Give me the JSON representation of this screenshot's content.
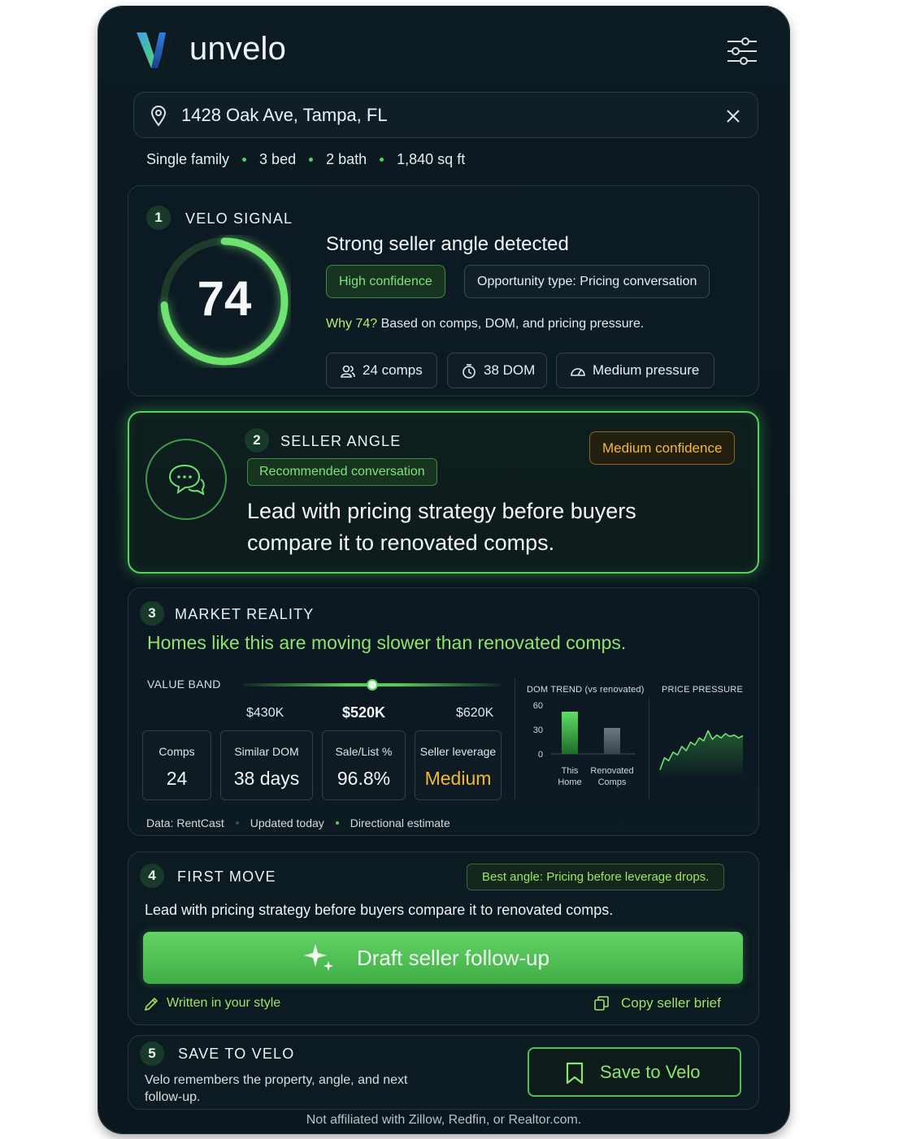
{
  "app": {
    "name": "unvelo"
  },
  "search": {
    "value": "1428 Oak Ave, Tampa, FL"
  },
  "facts": [
    "Single family",
    "3 bed",
    "2 bath",
    "1,840 sq ft"
  ],
  "signal": {
    "step": "1",
    "title": "VELO SIGNAL",
    "score": "74",
    "score_value": 74,
    "score_max": 100,
    "headline": "Strong seller angle detected",
    "confidence": "High confidence",
    "opportunity": "Opportunity type: Pricing conversation",
    "why_lead": "Why 74?",
    "why_text": " Based on comps, DOM, and pricing pressure.",
    "chips": [
      "24 comps",
      "38 DOM",
      "Medium pressure"
    ]
  },
  "seller_angle": {
    "step": "2",
    "title": "SELLER ANGLE",
    "confidence": "Medium confidence",
    "tag": "Recommended conversation",
    "message": "Lead with pricing strategy before buyers compare it to renovated comps."
  },
  "market": {
    "step": "3",
    "title": "MARKET REALITY",
    "subtitle": "Homes like this are moving slower than renovated comps.",
    "value_band": {
      "label": "VALUE BAND",
      "low": "$430K",
      "mid": "$520K",
      "high": "$620K",
      "position": 0.5
    },
    "stats": [
      {
        "label": "Comps",
        "value": "24"
      },
      {
        "label": "Similar DOM",
        "value": "38 days"
      },
      {
        "label": "Sale/List %",
        "value": "96.8%"
      },
      {
        "label": "Seller leverage",
        "value": "Medium"
      }
    ],
    "footer": [
      "Data: RentCast",
      "Updated today",
      "Directional estimate"
    ],
    "dom_trend_title": "DOM TREND (vs renovated)",
    "price_pressure_title": "PRICE PRESSURE"
  },
  "chart_data": [
    {
      "type": "bar",
      "title": "DOM TREND (vs renovated)",
      "categories": [
        "This Home",
        "Renovated Comps"
      ],
      "values": [
        52,
        32
      ],
      "yticks": [
        "60",
        "30",
        "0"
      ],
      "ylim": [
        0,
        60
      ]
    },
    {
      "type": "area",
      "title": "PRICE PRESSURE",
      "x": [
        0,
        1,
        2,
        3,
        4,
        5,
        6,
        7,
        8,
        9,
        10,
        11,
        12,
        13,
        14,
        15,
        16,
        17,
        18,
        19
      ],
      "values": [
        5,
        22,
        18,
        30,
        26,
        38,
        32,
        44,
        40,
        50,
        46,
        60,
        48,
        54,
        50,
        56,
        52,
        54,
        50,
        53
      ]
    }
  ],
  "first_move": {
    "step": "4",
    "title": "FIRST MOVE",
    "best_angle": "Best angle: Pricing before leverage drops.",
    "lead": "Lead with pricing strategy before buyers compare it to renovated comps.",
    "cta": "Draft seller follow-up",
    "style_note": "Written in your style",
    "copy": "Copy seller brief"
  },
  "save": {
    "step": "5",
    "title": "SAVE TO VELO",
    "desc": "Velo remembers the property, angle, and next follow-up.",
    "button": "Save to Velo"
  },
  "disclaimer": "Not affiliated with Zillow, Redfin, or Realtor.com.",
  "colors": {
    "accent": "#53cf55",
    "amber": "#f4b832",
    "bg": "#0b171e"
  }
}
